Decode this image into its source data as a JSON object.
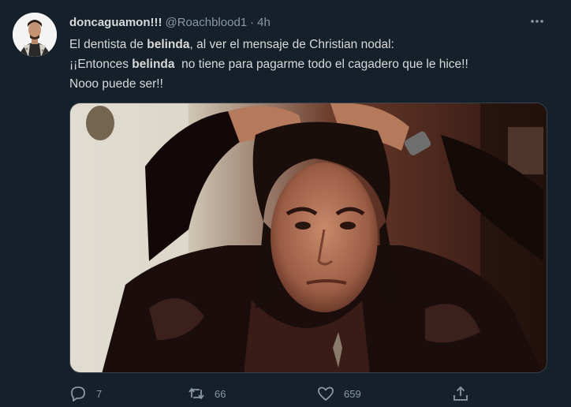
{
  "tweet": {
    "display_name": "doncaguamon!!!",
    "handle": "@Roachblood1",
    "separator": "·",
    "time": "4h",
    "text": {
      "line1_pre": "El dentista de ",
      "line1_bold": "belinda",
      "line1_post": ", al ver el mensaje de Christian nodal:",
      "line2_pre": "¡¡Entonces ",
      "line2_bold": "belinda",
      "line2_post": "  no tiene para pagarme todo el cagadero que le hice!!",
      "line3": "Nooo puede ser!!"
    },
    "media_description_icon": "photo-image",
    "actions": {
      "replies": "7",
      "retweets": "66",
      "likes": "659"
    }
  },
  "colors": {
    "background": "#15202b",
    "text_primary": "#d9d9d9",
    "text_secondary": "#8b98a5",
    "border": "#38444d"
  }
}
